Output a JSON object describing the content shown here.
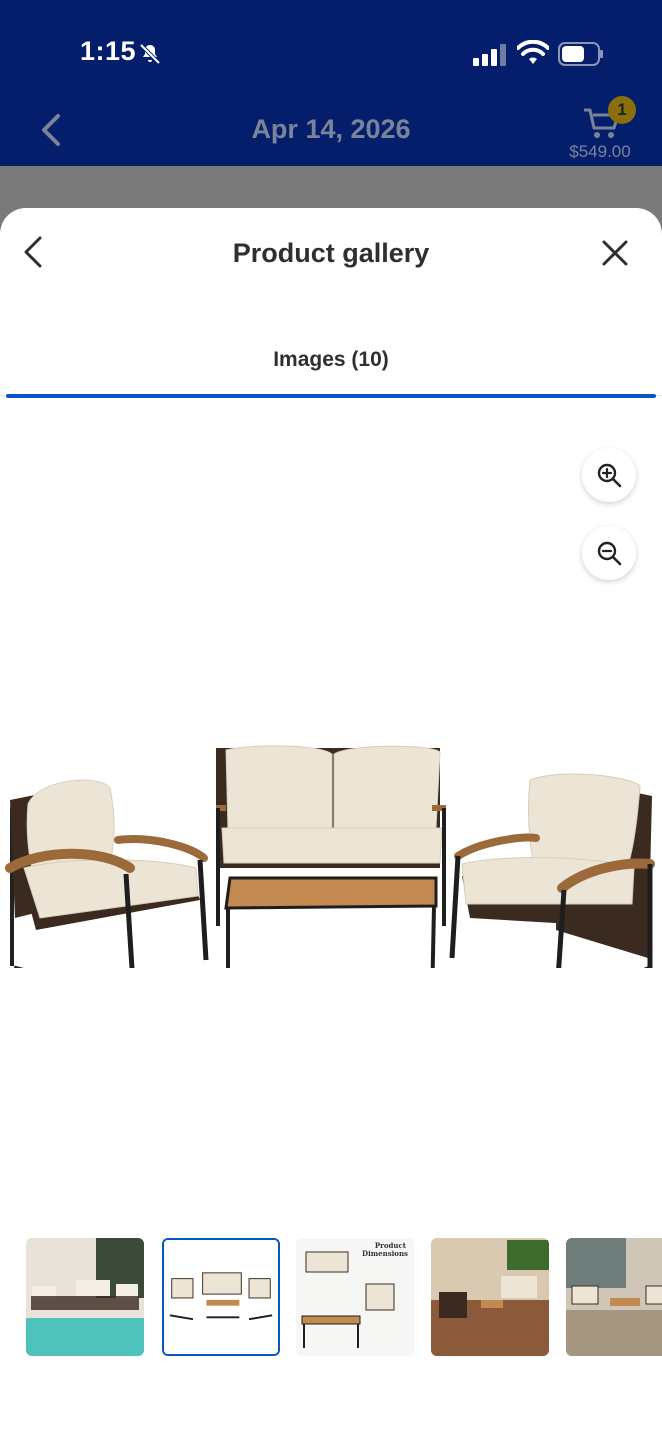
{
  "status_bar": {
    "time": "1:15"
  },
  "header": {
    "date": "Apr 14, 2026",
    "cart_count": "1",
    "cart_total": "$549.00"
  },
  "sheet": {
    "title": "Product gallery"
  },
  "tabs": [
    {
      "label": "Images (10)",
      "selected": true
    }
  ],
  "thumbnails": [
    {
      "description_icon": "image",
      "selected": false
    },
    {
      "description_icon": "image",
      "selected": true
    },
    {
      "description_icon": "image",
      "selected": false,
      "overlay_text": "Product Dimensions"
    },
    {
      "description_icon": "image",
      "selected": false
    },
    {
      "description_icon": "image",
      "selected": false
    }
  ],
  "colors": {
    "brand_navy": "#041e6c",
    "accent_blue": "#0a53c4",
    "cart_badge": "#8a6f0a"
  }
}
